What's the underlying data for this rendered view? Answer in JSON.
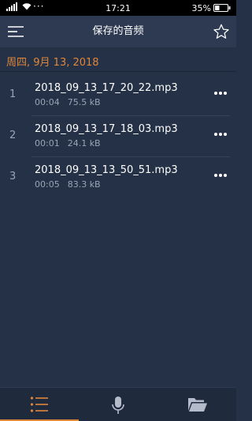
{
  "status_bar": {
    "time": "17:21",
    "battery_percent": "35%",
    "more_indicator": "···"
  },
  "header": {
    "title": "保存的音频",
    "menu_icon": "list-menu-icon",
    "star_icon": "star-outline-icon"
  },
  "date_group": {
    "label": "周四, 9月 13, 2018"
  },
  "recordings": [
    {
      "index": "1",
      "name": "2018_09_13_17_20_22.mp3",
      "duration": "00:04",
      "size": "75.5 kB"
    },
    {
      "index": "2",
      "name": "2018_09_13_17_18_03.mp3",
      "duration": "00:01",
      "size": "24.1 kB"
    },
    {
      "index": "3",
      "name": "2018_09_13_13_50_51.mp3",
      "duration": "00:05",
      "size": "83.3 kB"
    }
  ],
  "bottom_nav": {
    "items": [
      "list-icon",
      "microphone-icon",
      "folder-open-icon"
    ],
    "active_index": 0
  },
  "colors": {
    "accent": "#e0873a",
    "background": "#243146",
    "header": "#2d3a52",
    "nav": "#1f2a3c",
    "secondary_text": "#9aa4b5"
  }
}
